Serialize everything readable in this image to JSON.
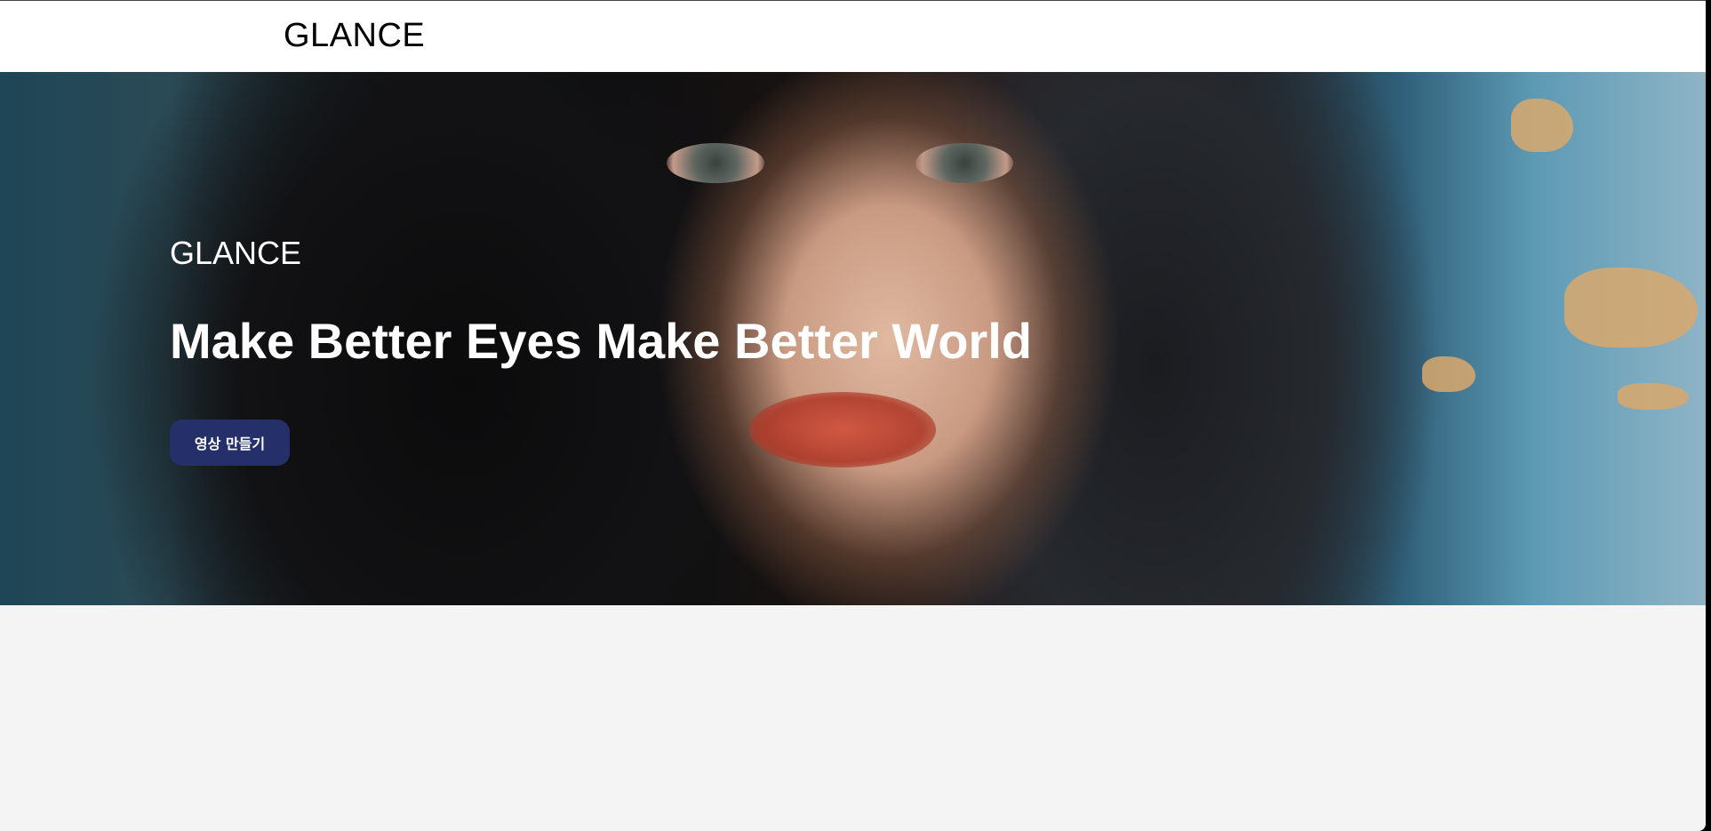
{
  "header": {
    "logo": "GLANCE"
  },
  "hero": {
    "subtitle": "GLANCE",
    "title": "Make Better Eyes Make Better World",
    "cta_label": "영상 만들기"
  }
}
